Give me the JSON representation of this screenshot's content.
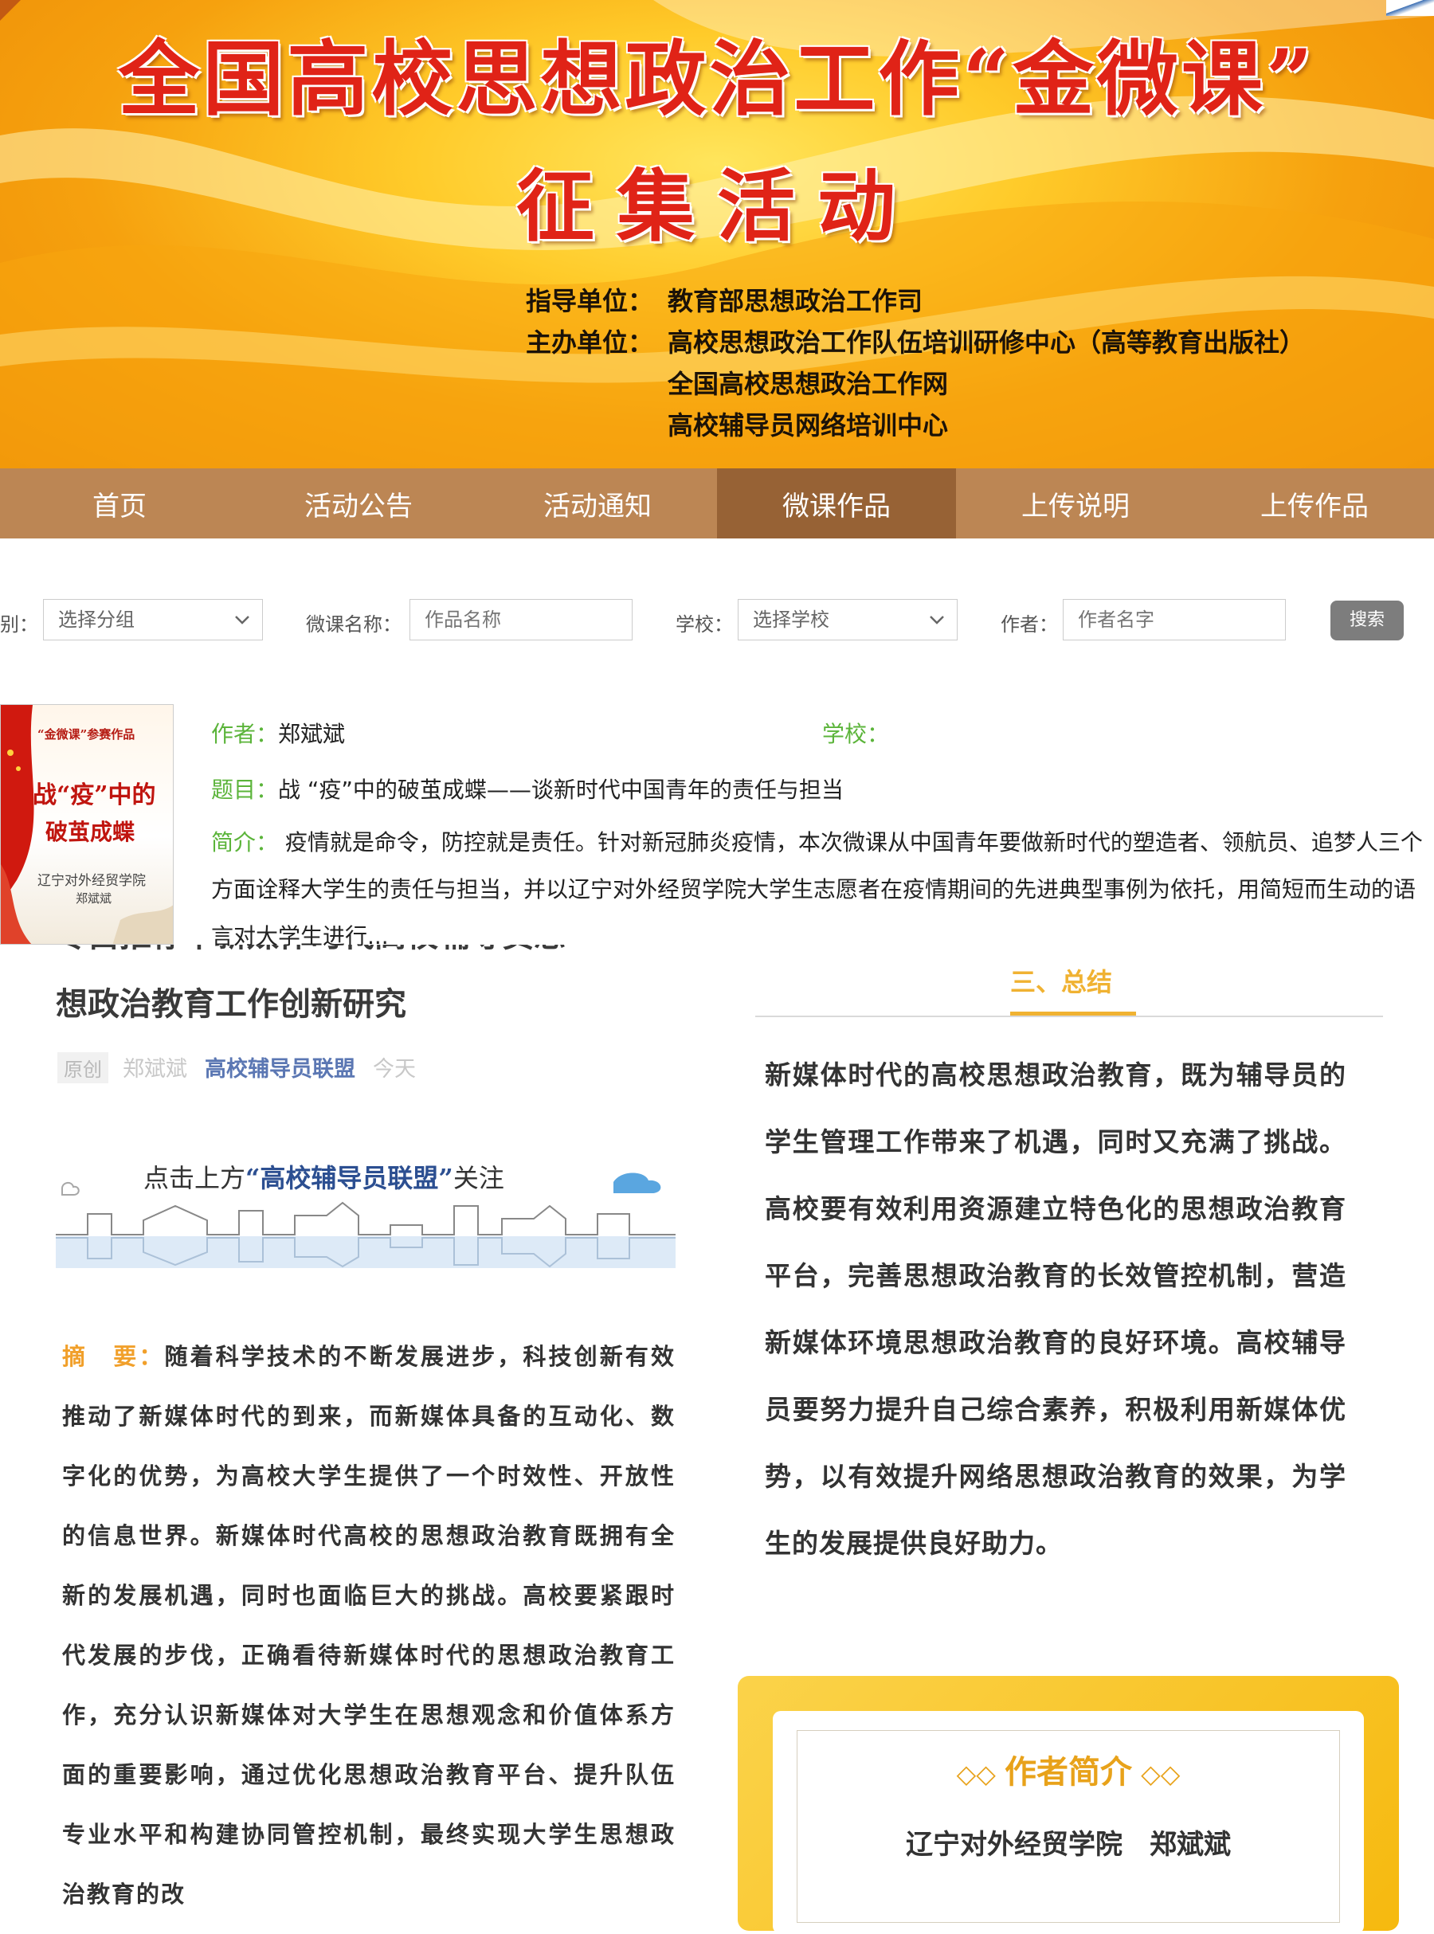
{
  "banner": {
    "title_line1": "全国高校思想政治工作“金微课”",
    "title_line2": "征集活动",
    "guide_label": "指导单位：",
    "guide_value": "教育部思想政治工作司",
    "host_label": "主办单位：",
    "host_values": [
      "高校思想政治工作队伍培训研修中心（高等教育出版社）",
      "全国高校思想政治工作网",
      "高校辅导员网络培训中心"
    ]
  },
  "nav": {
    "items": [
      "首页",
      "活动公告",
      "活动通知",
      "微课作品",
      "上传说明",
      "上传作品"
    ],
    "active_index": 3
  },
  "search": {
    "group_label": "别：",
    "group_value": "选择分组",
    "name_label": "微课名称：",
    "name_placeholder": "作品名称",
    "school_label": "学校：",
    "school_value": "选择学校",
    "author_label": "作者：",
    "author_placeholder": "作者名字",
    "button": "搜索"
  },
  "result": {
    "thumb": {
      "top_text": "“金微课”参赛作品",
      "title_line1": "战“疫”中的",
      "title_line2": "破茧成蝶",
      "school": "辽宁对外经贸学院",
      "author": "郑斌斌"
    },
    "author_label": "作者：",
    "author": "郑斌斌",
    "school_label": "学校：",
    "school": "",
    "topic_label": "题目：",
    "topic": "战 “疫”中的破茧成蝶——谈新时代中国青年的责任与担当",
    "desc_label": "简介：",
    "desc": "  疫情就是命令，防控就是责任。针对新冠肺炎疫情，本次微课从中国青年要做新时代的塑造者、领航员、追梦人三个方面诠释大学生的责任与担当，并以辽宁对外经贸学院大学生志愿者在疫情期间的先进典型事例为依托，用简短而生动的语言对大学生进行..."
  },
  "article": {
    "cut_title": "专白推荐丨新媒体时代高校辅导员思",
    "title": "想政治教育工作创新研究",
    "meta_original": "原创",
    "meta_author": "郑斌斌",
    "meta_account": "高校辅导员联盟",
    "meta_date": "今天",
    "follow_prefix": "点击上方",
    "follow_strong": "“高校辅导员联盟”",
    "follow_suffix": "关注",
    "abstract_label": "摘　要：",
    "abstract": "随着科学技术的不断发展进步，科技创新有效推动了新媒体时代的到来，而新媒体具备的互动化、数字化的优势，为高校大学生提供了一个时效性、开放性的信息世界。新媒体时代高校的思想政治教育既拥有全新的发展机遇，同时也面临巨大的挑战。高校要紧跟时代发展的步伐，正确看待新媒体时代的思想政治教育工作，充分认识新媒体对大学生在思想观念和价值体系方面的重要影响，通过优化思想政治教育平台、提升队伍专业水平和构建协同管控机制，最终实现大学生思想政治教育的改",
    "section_heading": "三、总结",
    "summary": "新媒体时代的高校思想政治教育，既为辅导员的学生管理工作带来了机遇，同时又充满了挑战。高校要有效利用资源建立特色化的思想政治教育平台，完善思想政治教育的长效管控机制，营造新媒体环境思想政治教育的良好环境。高校辅导员要努力提升自己综合素养，积极利用新媒体优势，以有效提升网络思想政治教育的效果，为学生的发展提供良好助力。",
    "card_title": "作者简介",
    "card_text": "辽宁对外经贸学院　郑斌斌"
  },
  "colors": {
    "banner_title": "#e02317",
    "nav_bg": "#bc8654",
    "nav_active": "#976235",
    "label_green": "#5bb43a",
    "accent_gold": "#f0b232"
  }
}
